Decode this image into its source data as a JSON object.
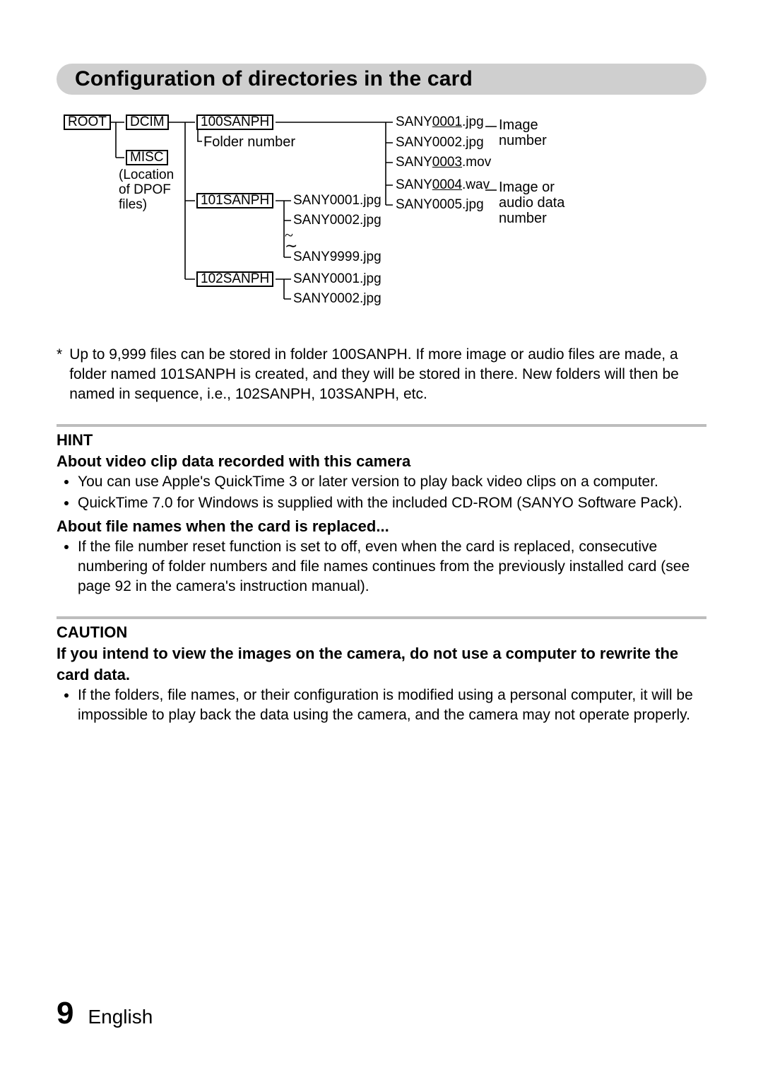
{
  "header": {
    "title": "Configuration of directories in the card"
  },
  "diagram": {
    "root": "ROOT",
    "dcim": "DCIM",
    "misc": "MISC",
    "misc_note_l1": "(Location",
    "misc_note_l2": "of DPOF",
    "misc_note_l3": "files)",
    "folder100": "100SANPH",
    "folder_number_label": "Folder number",
    "folder101": "101SANPH",
    "folder102": "102SANPH",
    "f101_a": "SANY0001.jpg",
    "f101_b": "SANY0002.jpg",
    "f101_c": "SANY9999.jpg",
    "f102_a": "SANY0001.jpg",
    "f102_b": "SANY0002.jpg",
    "right_1a": "SANY",
    "right_1b": "0001",
    "right_1c": ".jpg",
    "right_2": "SANY0002.jpg",
    "right_3a": "SANY",
    "right_3b": "0003",
    "right_3c": ".mov",
    "right_4a": "SANY",
    "right_4b": "0004",
    "right_4c": ".wav",
    "right_5": "SANY0005.jpg",
    "image_number_l1": "Image",
    "image_number_l2": "number",
    "audio_number_l1": "Image or",
    "audio_number_l2": "audio data",
    "audio_number_l3": "number",
    "tilde1": "~",
    "tilde2": "∼"
  },
  "note": {
    "marker": "*",
    "text": "Up to 9,999 files can be stored in folder 100SANPH. If more image or audio files are made, a folder named 101SANPH is created, and they will be stored in there. New folders will then be named in sequence, i.e., 102SANPH, 103SANPH, etc."
  },
  "hint": {
    "title": "HINT",
    "sub1": "About video clip data recorded with this camera",
    "sub1_items": [
      "You can use Apple's QuickTime 3 or later version to play back video clips on a computer.",
      "QuickTime 7.0 for Windows is supplied with the included CD-ROM (SANYO Software Pack)."
    ],
    "sub2": "About file names when the card is replaced...",
    "sub2_items": [
      "If the file number reset function is set to off, even when the card is replaced, consecutive numbering of folder numbers and file names continues from the previously installed card (see page 92 in the camera's instruction manual)."
    ]
  },
  "caution": {
    "title": "CAUTION",
    "sub": "If you intend to view the images on the camera, do not use a computer to rewrite the card data.",
    "items": [
      "If the folders, file names, or their configuration is modified using a personal computer, it will be impossible to play back the data using the camera, and the camera may not operate properly."
    ]
  },
  "footer": {
    "page": "9",
    "lang": "English"
  }
}
